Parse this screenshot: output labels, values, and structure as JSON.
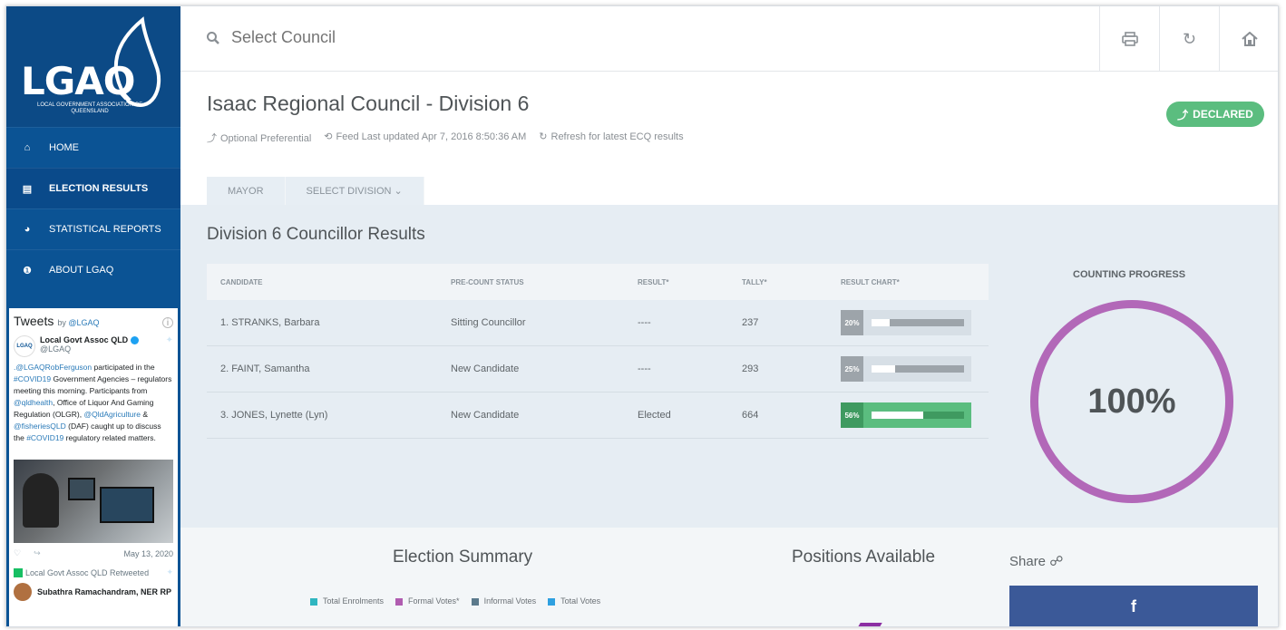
{
  "sidebar": {
    "logo_text": "LGAQ",
    "logo_sub": "LOCAL GOVERNMENT ASSOCIATION OF QUEENSLAND",
    "items": [
      {
        "label": "HOME",
        "icon": "home-icon"
      },
      {
        "label": "ELECTION RESULTS",
        "icon": "bar-chart-icon"
      },
      {
        "label": "STATISTICAL REPORTS",
        "icon": "pie-chart-icon"
      },
      {
        "label": "ABOUT LGAQ",
        "icon": "info-icon"
      }
    ]
  },
  "tweets": {
    "title": "Tweets",
    "by": "by",
    "handle_link": "@LGAQ",
    "user_name": "Local Govt Assoc QLD",
    "user_handle": "@LGAQ",
    "avatar_text": "LGAQ",
    "text_parts": [
      {
        "t": ".@LGAQRobFerguson",
        "link": true
      },
      {
        "t": " participated in the ",
        "link": false
      },
      {
        "t": "#COVID19",
        "link": true
      },
      {
        "t": " Government Agencies – regulators meeting this morning. Participants from ",
        "link": false
      },
      {
        "t": "@qldhealth",
        "link": true
      },
      {
        "t": ", Office of Liquor And Gaming Regulation (OLGR), ",
        "link": false
      },
      {
        "t": "@QldAgriculture",
        "link": true
      },
      {
        "t": " & ",
        "link": false
      },
      {
        "t": "@fisheriesQLD",
        "link": true
      },
      {
        "t": " (DAF) caught up to discuss the ",
        "link": false
      },
      {
        "t": "#COVID19",
        "link": true
      },
      {
        "t": " regulatory related matters.",
        "link": false
      }
    ],
    "date": "May 13, 2020",
    "retweet_label": "Local Govt Assoc QLD Retweeted",
    "next_user": "Subathra Ramachandram, NER RP"
  },
  "topbar": {
    "search_placeholder": "Select Council"
  },
  "header": {
    "title": "Isaac Regional Council - Division 6",
    "voting_system": "Optional Preferential",
    "feed_updated": "Feed Last updated Apr 7, 2016 8:50:36 AM",
    "refresh_text": "Refresh for latest ECQ results",
    "status_badge": "DECLARED",
    "tabs": [
      "MAYOR",
      "SELECT DIVISION ⌄"
    ]
  },
  "results": {
    "title": "Division 6 Councillor Results",
    "columns": [
      "CANDIDATE",
      "PRE-COUNT STATUS",
      "RESULT*",
      "TALLY*",
      "RESULT CHART*"
    ],
    "rows": [
      {
        "candidate": "1. STRANKS, Barbara",
        "status": "Sitting Councillor",
        "result": "----",
        "tally": "237",
        "pct_label": "20%",
        "pct": 0.2,
        "winner": false
      },
      {
        "candidate": "2. FAINT, Samantha",
        "status": "New Candidate",
        "result": "----",
        "tally": "293",
        "pct_label": "25%",
        "pct": 0.25,
        "winner": false
      },
      {
        "candidate": "3. JONES, Lynette (Lyn)",
        "status": "New Candidate",
        "result": "Elected",
        "tally": "664",
        "pct_label": "56%",
        "pct": 0.56,
        "winner": true
      }
    ]
  },
  "progress": {
    "label": "COUNTING PROGRESS",
    "value": "100%",
    "color": "#b268b8"
  },
  "summary": {
    "title": "Election Summary",
    "legend": [
      {
        "label": "Total Enrolments",
        "color": "#2fb5c0"
      },
      {
        "label": "Formal Votes*",
        "color": "#b05cb0"
      },
      {
        "label": "Informal Votes",
        "color": "#5c7a8c"
      },
      {
        "label": "Total Votes",
        "color": "#2ea0e0"
      }
    ],
    "positions_title": "Positions Available",
    "share_label": "Share",
    "facebook_label": "f"
  }
}
